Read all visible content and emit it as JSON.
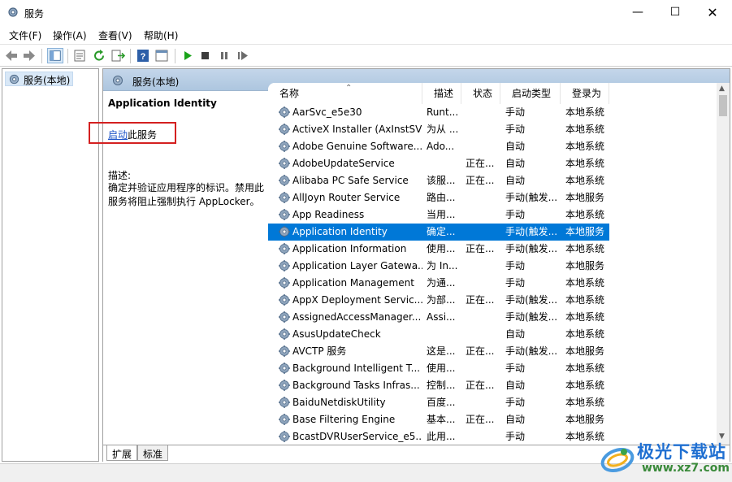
{
  "window": {
    "title": "服务",
    "minimize": "—",
    "maximize": "☐",
    "close": "✕"
  },
  "menu": [
    "文件(F)",
    "操作(A)",
    "查看(V)",
    "帮助(H)"
  ],
  "tree": {
    "root": "服务(本地)"
  },
  "header": {
    "title": "服务(本地)"
  },
  "details": {
    "service_name": "Application Identity",
    "start_link": "启动",
    "start_suffix": "此服务",
    "desc_label": "描述:",
    "description": "确定并验证应用程序的标识。禁用此服务将阻止强制执行 AppLocker。"
  },
  "columns": [
    "名称",
    "描述",
    "状态",
    "启动类型",
    "登录为"
  ],
  "services": [
    {
      "name": "AarSvc_e5e30",
      "desc": "Runt...",
      "status": "",
      "startup": "手动",
      "logon": "本地系统"
    },
    {
      "name": "ActiveX Installer (AxInstSV)",
      "desc": "为从 ...",
      "status": "",
      "startup": "手动",
      "logon": "本地系统"
    },
    {
      "name": "Adobe Genuine Software...",
      "desc": "Ado...",
      "status": "",
      "startup": "自动",
      "logon": "本地系统"
    },
    {
      "name": "AdobeUpdateService",
      "desc": "",
      "status": "正在...",
      "startup": "自动",
      "logon": "本地系统"
    },
    {
      "name": "Alibaba PC Safe Service",
      "desc": "该服...",
      "status": "正在...",
      "startup": "自动",
      "logon": "本地系统"
    },
    {
      "name": "AllJoyn Router Service",
      "desc": "路由...",
      "status": "",
      "startup": "手动(触发...",
      "logon": "本地服务"
    },
    {
      "name": "App Readiness",
      "desc": "当用...",
      "status": "",
      "startup": "手动",
      "logon": "本地系统"
    },
    {
      "name": "Application Identity",
      "desc": "确定...",
      "status": "",
      "startup": "手动(触发...",
      "logon": "本地服务"
    },
    {
      "name": "Application Information",
      "desc": "使用...",
      "status": "正在...",
      "startup": "手动(触发...",
      "logon": "本地系统"
    },
    {
      "name": "Application Layer Gatewa...",
      "desc": "为 In...",
      "status": "",
      "startup": "手动",
      "logon": "本地服务"
    },
    {
      "name": "Application Management",
      "desc": "为通...",
      "status": "",
      "startup": "手动",
      "logon": "本地系统"
    },
    {
      "name": "AppX Deployment Servic...",
      "desc": "为部...",
      "status": "正在...",
      "startup": "手动(触发...",
      "logon": "本地系统"
    },
    {
      "name": "AssignedAccessManager...",
      "desc": "Assi...",
      "status": "",
      "startup": "手动(触发...",
      "logon": "本地系统"
    },
    {
      "name": "AsusUpdateCheck",
      "desc": "",
      "status": "",
      "startup": "自动",
      "logon": "本地系统"
    },
    {
      "name": "AVCTP 服务",
      "desc": "这是...",
      "status": "正在...",
      "startup": "手动(触发...",
      "logon": "本地服务"
    },
    {
      "name": "Background Intelligent T...",
      "desc": "使用...",
      "status": "",
      "startup": "手动",
      "logon": "本地系统"
    },
    {
      "name": "Background Tasks Infras...",
      "desc": "控制...",
      "status": "正在...",
      "startup": "自动",
      "logon": "本地系统"
    },
    {
      "name": "BaiduNetdiskUtility",
      "desc": "百度...",
      "status": "",
      "startup": "手动",
      "logon": "本地系统"
    },
    {
      "name": "Base Filtering Engine",
      "desc": "基本...",
      "status": "正在...",
      "startup": "自动",
      "logon": "本地服务"
    },
    {
      "name": "BcastDVRUserService_e5...",
      "desc": "此用...",
      "status": "",
      "startup": "手动",
      "logon": "本地系统"
    }
  ],
  "selected_index": 7,
  "tabs": [
    "扩展",
    "标准"
  ],
  "watermark": {
    "main": "极光下载站",
    "url": "www.xz7.com"
  },
  "colors": {
    "selection": "#0078d7",
    "link": "#1b52c7",
    "highlight_box": "#d42020",
    "header": "#b9cfe6"
  }
}
